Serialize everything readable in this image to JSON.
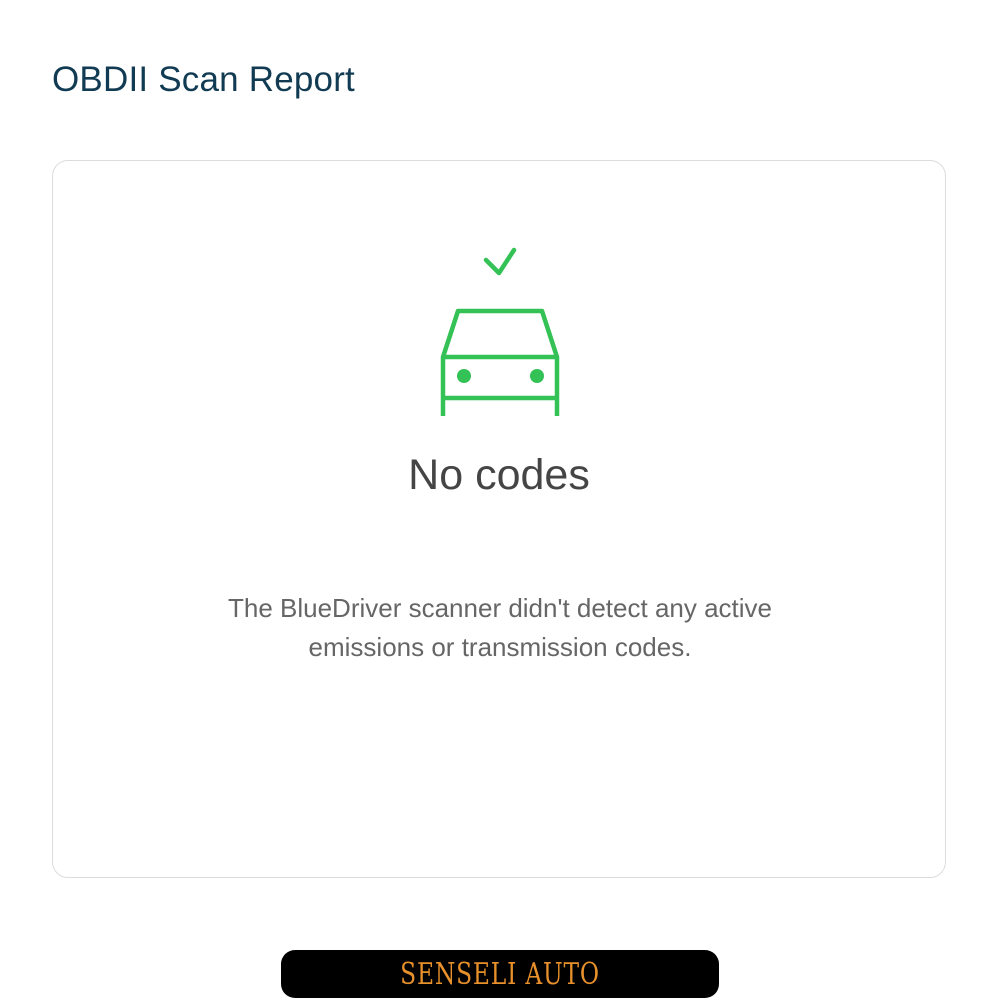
{
  "header": {
    "title": "OBDII Scan Report"
  },
  "report_card": {
    "icon": "car-checkmark-icon",
    "status_title": "No codes",
    "status_message_line1": "The BlueDriver scanner didn't detect any active",
    "status_message_line2": "emissions or transmission codes."
  },
  "footer": {
    "watermark": "SENSELI AUTO"
  },
  "colors": {
    "title": "#113b52",
    "success_green": "#34c156",
    "card_border": "#dcdcdc",
    "banner_bg": "#000000",
    "banner_text": "#e8902b"
  }
}
